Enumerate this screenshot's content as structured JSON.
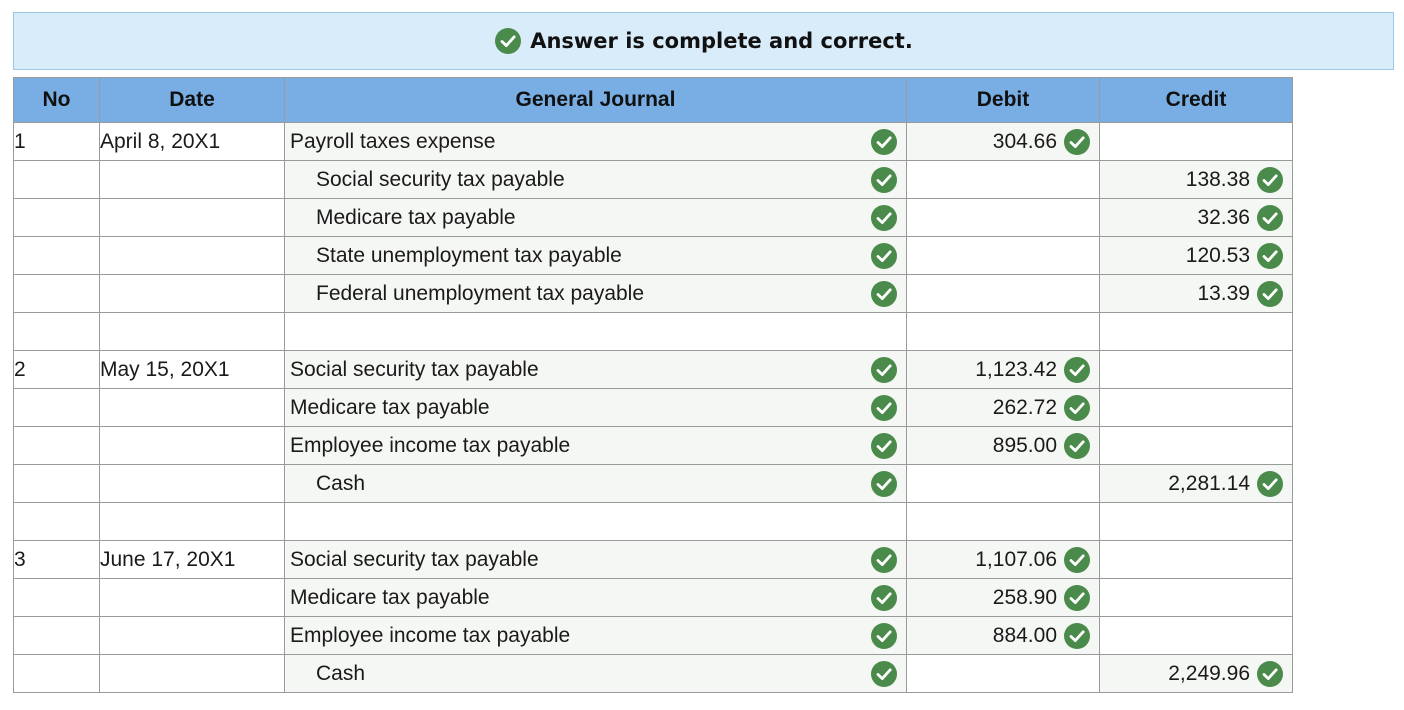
{
  "banner": {
    "text": "Answer is complete and correct.",
    "icon": "check-circle-icon",
    "background": "#d9ecf9"
  },
  "colors": {
    "header_bg": "#78aee3",
    "check_green": "#4a8a4a"
  },
  "table": {
    "headers": {
      "no": "No",
      "date": "Date",
      "journal": "General Journal",
      "debit": "Debit",
      "credit": "Credit"
    },
    "rows": [
      {
        "no": "1",
        "date": "April 8, 20X1",
        "account": "Payroll taxes expense",
        "indent": false,
        "debit": "304.66",
        "credit": ""
      },
      {
        "no": "",
        "date": "",
        "account": "Social security tax payable",
        "indent": true,
        "debit": "",
        "credit": "138.38"
      },
      {
        "no": "",
        "date": "",
        "account": "Medicare tax payable",
        "indent": true,
        "debit": "",
        "credit": "32.36"
      },
      {
        "no": "",
        "date": "",
        "account": "State unemployment tax payable",
        "indent": true,
        "debit": "",
        "credit": "120.53"
      },
      {
        "no": "",
        "date": "",
        "account": "Federal unemployment tax payable",
        "indent": true,
        "debit": "",
        "credit": "13.39"
      },
      {
        "spacer": true
      },
      {
        "no": "2",
        "date": "May 15, 20X1",
        "account": "Social security tax payable",
        "indent": false,
        "debit": "1,123.42",
        "credit": ""
      },
      {
        "no": "",
        "date": "",
        "account": "Medicare tax payable",
        "indent": false,
        "debit": "262.72",
        "credit": ""
      },
      {
        "no": "",
        "date": "",
        "account": "Employee income tax payable",
        "indent": false,
        "debit": "895.00",
        "credit": ""
      },
      {
        "no": "",
        "date": "",
        "account": "Cash",
        "indent": true,
        "debit": "",
        "credit": "2,281.14"
      },
      {
        "spacer": true
      },
      {
        "no": "3",
        "date": "June 17, 20X1",
        "account": "Social security tax payable",
        "indent": false,
        "debit": "1,107.06",
        "credit": ""
      },
      {
        "no": "",
        "date": "",
        "account": "Medicare tax payable",
        "indent": false,
        "debit": "258.90",
        "credit": ""
      },
      {
        "no": "",
        "date": "",
        "account": "Employee income tax payable",
        "indent": false,
        "debit": "884.00",
        "credit": ""
      },
      {
        "no": "",
        "date": "",
        "account": "Cash",
        "indent": true,
        "debit": "",
        "credit": "2,249.96"
      }
    ]
  }
}
